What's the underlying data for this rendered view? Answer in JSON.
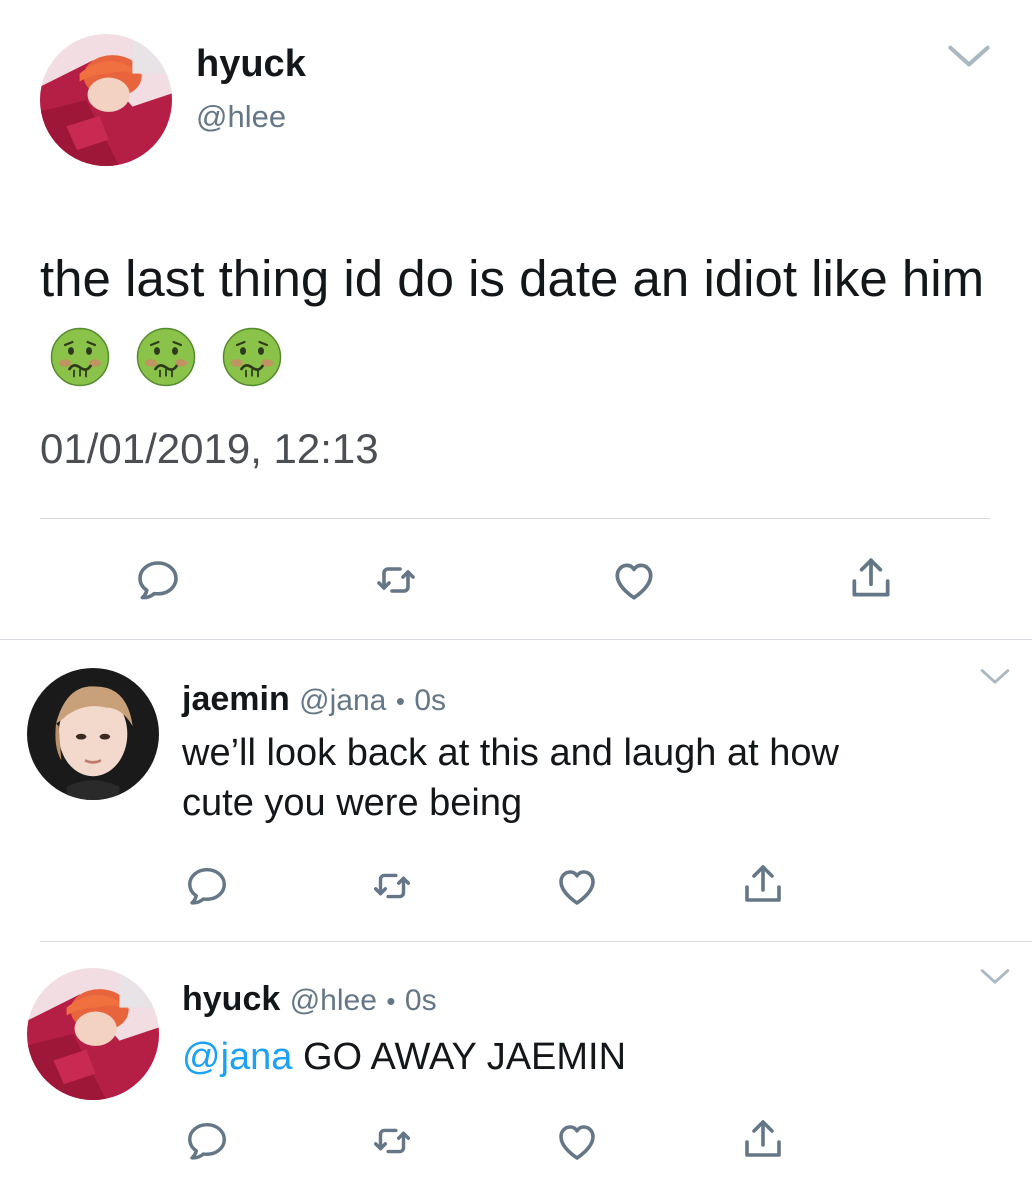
{
  "main_tweet": {
    "display_name": "hyuck",
    "handle": "@hlee",
    "text": "the last thing id do is date an idiot like him",
    "emoji_count": 3,
    "emoji_icon": "nauseated-face-icon",
    "timestamp": "01/01/2019, 12:13"
  },
  "replies": [
    {
      "display_name": "jaemin",
      "handle": "@jana",
      "separator": "•",
      "time": "0s",
      "text_line1": "we’ll look back at this and laugh at how",
      "text_line2": "cute you were being"
    },
    {
      "display_name": "hyuck",
      "handle": "@hlee",
      "separator": "•",
      "time": "0s",
      "mention": "@jana",
      "text": " GO AWAY JAEMIN"
    }
  ],
  "icons": {
    "reply": "reply-icon",
    "retweet": "retweet-icon",
    "like": "heart-icon",
    "share": "share-icon",
    "menu": "chevron-down-icon"
  },
  "colors": {
    "text": "#14171a",
    "muted": "#657786",
    "link": "#1da1f2",
    "divider": "#d6dbdf"
  }
}
